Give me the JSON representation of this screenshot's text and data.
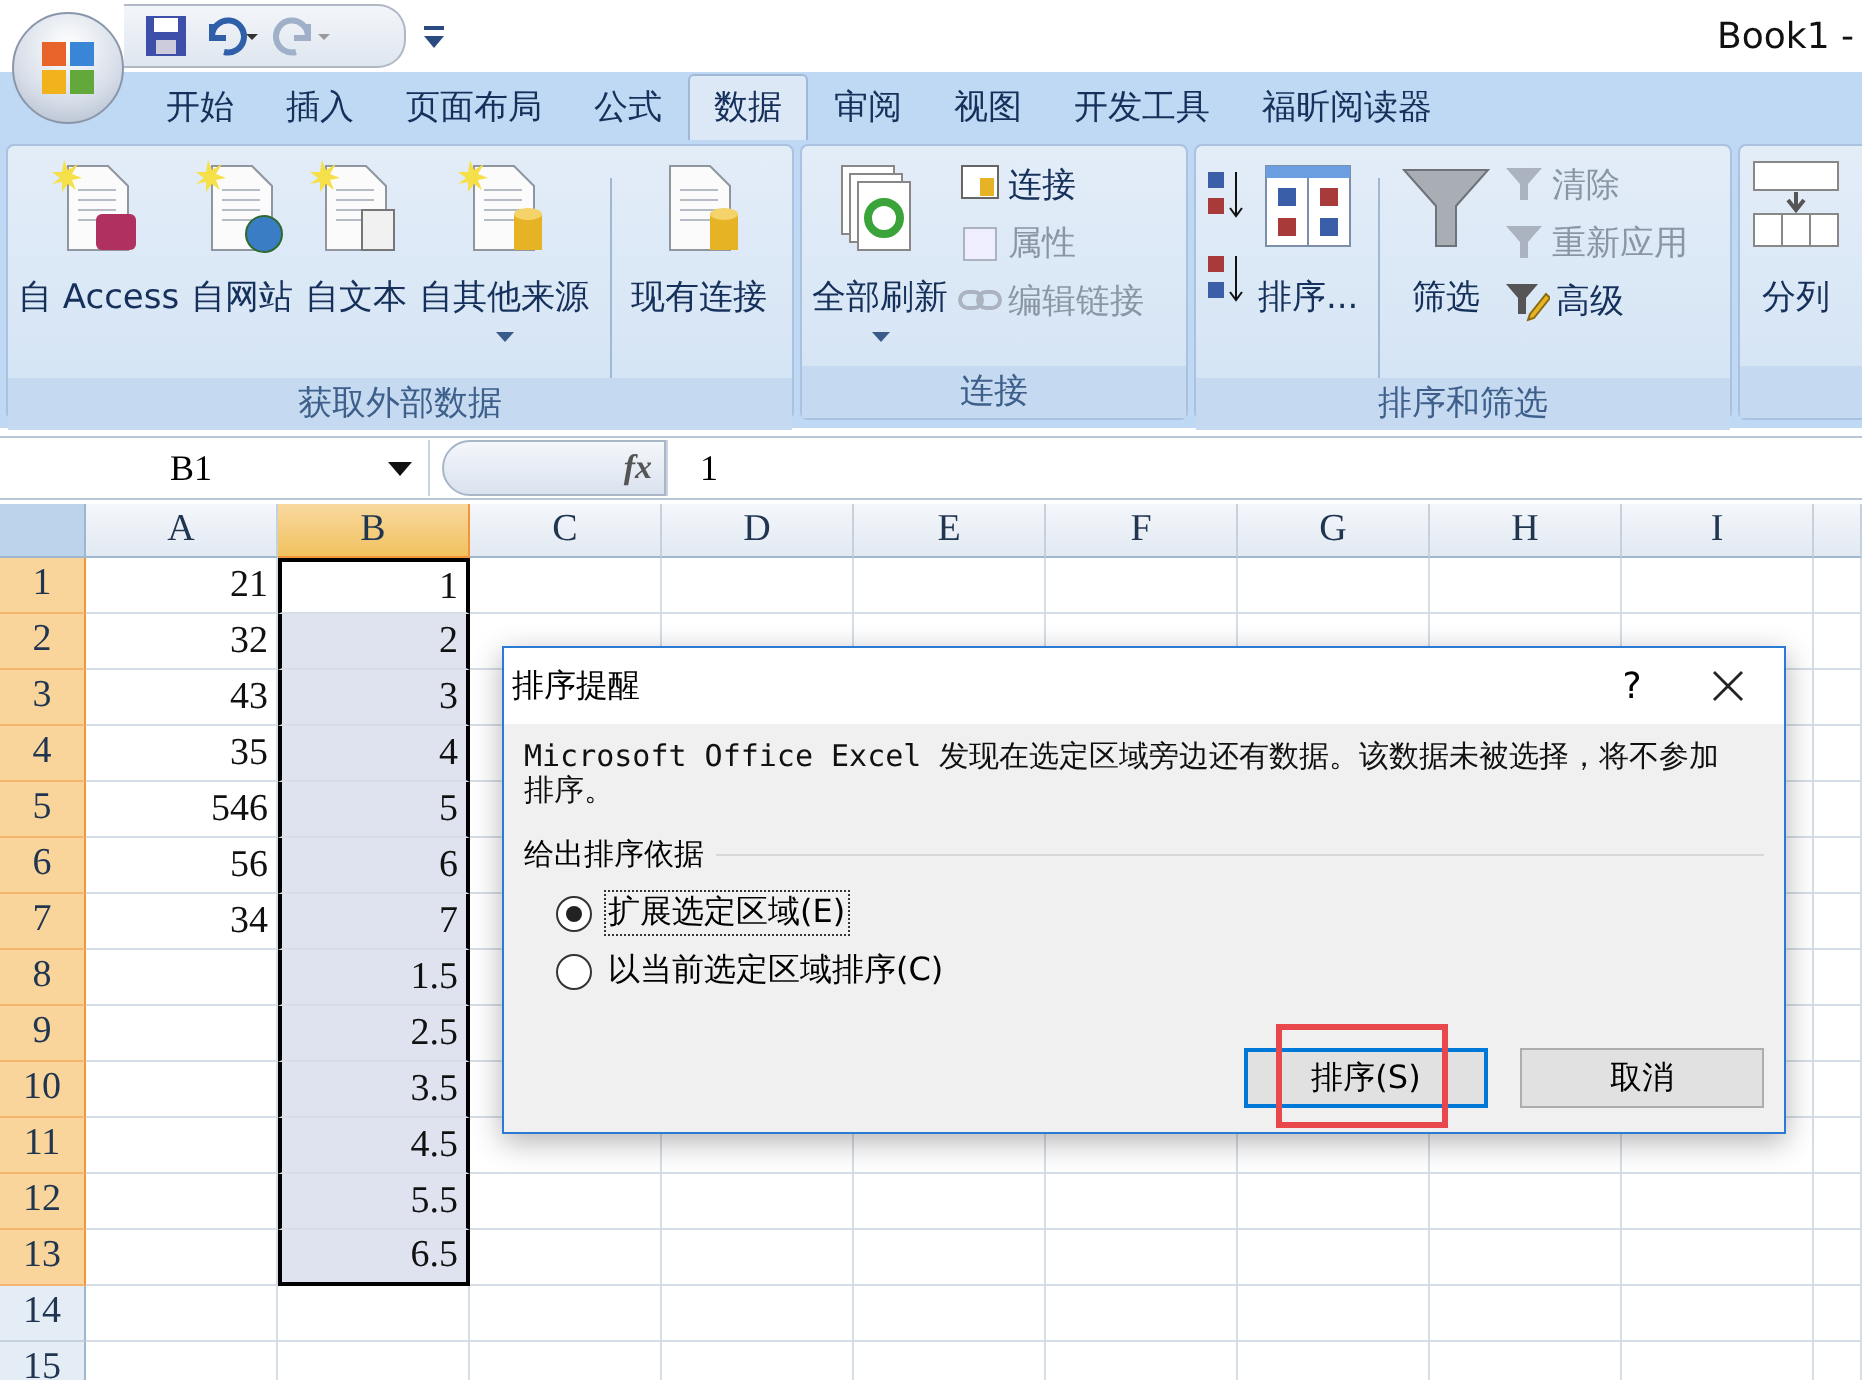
{
  "title_bar": {
    "title": "Book1 -"
  },
  "tabs": [
    {
      "label": "开始",
      "selected": false
    },
    {
      "label": "插入",
      "selected": false
    },
    {
      "label": "页面布局",
      "selected": false
    },
    {
      "label": "公式",
      "selected": false
    },
    {
      "label": "数据",
      "selected": true
    },
    {
      "label": "审阅",
      "selected": false
    },
    {
      "label": "视图",
      "selected": false
    },
    {
      "label": "开发工具",
      "selected": false
    },
    {
      "label": "福昕阅读器",
      "selected": false
    }
  ],
  "ribbon_groups": [
    {
      "title": "获取外部数据",
      "items": [
        {
          "kind": "large",
          "label": "自 Access",
          "dropdown": false
        },
        {
          "kind": "large",
          "label": "自网站",
          "dropdown": false
        },
        {
          "kind": "large",
          "label": "自文本",
          "dropdown": false
        },
        {
          "kind": "large",
          "label": "自其他来源",
          "dropdown": true
        },
        {
          "kind": "separator"
        },
        {
          "kind": "large",
          "label": "现有连接",
          "dropdown": false
        }
      ]
    },
    {
      "title": "连接",
      "items": [
        {
          "kind": "large",
          "label": "全部刷新",
          "dropdown": true
        },
        {
          "kind": "stack",
          "buttons": [
            {
              "label": "连接",
              "disabled": false
            },
            {
              "label": "属性",
              "disabled": true
            },
            {
              "label": "编辑链接",
              "disabled": true
            }
          ]
        }
      ]
    },
    {
      "title": "排序和筛选",
      "items": [
        {
          "kind": "sort_icons"
        },
        {
          "kind": "large",
          "label": "排序...",
          "dropdown": false
        },
        {
          "kind": "separator"
        },
        {
          "kind": "large",
          "label": "筛选",
          "dropdown": false
        },
        {
          "kind": "stack",
          "buttons": [
            {
              "label": "清除",
              "disabled": true
            },
            {
              "label": "重新应用",
              "disabled": true
            },
            {
              "label": "高级",
              "disabled": false
            }
          ]
        }
      ]
    },
    {
      "items": [
        {
          "kind": "large",
          "label": "分列",
          "dropdown": false
        }
      ]
    }
  ],
  "formula_bar": {
    "name_box": "B1",
    "function_label": "fx",
    "value": "1"
  },
  "columns": [
    {
      "label": "A",
      "selected": false
    },
    {
      "label": "B",
      "selected": true
    },
    {
      "label": "C",
      "selected": false
    },
    {
      "label": "D",
      "selected": false
    },
    {
      "label": "E",
      "selected": false
    },
    {
      "label": "F",
      "selected": false
    },
    {
      "label": "G",
      "selected": false
    },
    {
      "label": "H",
      "selected": false
    },
    {
      "label": "I",
      "selected": false
    }
  ],
  "rows": [
    {
      "header": "1",
      "selected": true,
      "cells": [
        "21",
        "1"
      ]
    },
    {
      "header": "2",
      "selected": true,
      "cells": [
        "32",
        "2"
      ]
    },
    {
      "header": "3",
      "selected": true,
      "cells": [
        "43",
        "3"
      ]
    },
    {
      "header": "4",
      "selected": true,
      "cells": [
        "35",
        "4"
      ]
    },
    {
      "header": "5",
      "selected": true,
      "cells": [
        "546",
        "5"
      ]
    },
    {
      "header": "6",
      "selected": true,
      "cells": [
        "56",
        "6"
      ]
    },
    {
      "header": "7",
      "selected": true,
      "cells": [
        "34",
        "7"
      ]
    },
    {
      "header": "8",
      "selected": true,
      "cells": [
        "",
        "1.5"
      ]
    },
    {
      "header": "9",
      "selected": true,
      "cells": [
        "",
        "2.5"
      ]
    },
    {
      "header": "10",
      "selected": true,
      "cells": [
        "",
        "3.5"
      ]
    },
    {
      "header": "11",
      "selected": true,
      "cells": [
        "",
        "4.5"
      ]
    },
    {
      "header": "12",
      "selected": true,
      "cells": [
        "",
        "5.5"
      ]
    },
    {
      "header": "13",
      "selected": true,
      "cells": [
        "",
        "6.5"
      ]
    },
    {
      "header": "14",
      "selected": false,
      "cells": []
    },
    {
      "header": "15",
      "selected": false,
      "cells": []
    }
  ],
  "dialog": {
    "title": "排序提醒",
    "help": "?",
    "message": "Microsoft Office Excel 发现在选定区域旁边还有数据。该数据未被选择，将不参加排序。",
    "group_label": "给出排序依据",
    "options": [
      {
        "label": "扩展选定区域(E)",
        "selected": true
      },
      {
        "label": "以当前选定区域排序(C)",
        "selected": false
      }
    ],
    "buttons": [
      {
        "label": "排序(S)",
        "default": true,
        "highlighted": true
      },
      {
        "label": "取消",
        "default": false,
        "highlighted": false
      }
    ]
  }
}
